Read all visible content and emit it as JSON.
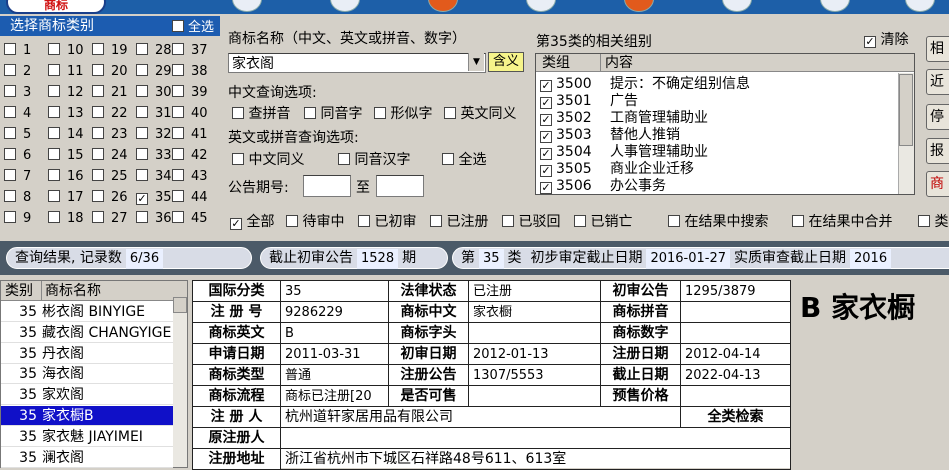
{
  "app": {
    "logo_text": "商标"
  },
  "category_panel": {
    "title": "选择商标类别",
    "select_all": "全选",
    "columns": [
      [
        "1",
        "2",
        "3",
        "4",
        "5",
        "6",
        "7",
        "8",
        "9"
      ],
      [
        "10",
        "11",
        "12",
        "13",
        "14",
        "15",
        "16",
        "17",
        "18"
      ],
      [
        "19",
        "20",
        "21",
        "22",
        "23",
        "24",
        "25",
        "26",
        "27"
      ],
      [
        "28",
        "29",
        "30",
        "31",
        "32",
        "33",
        "34",
        "35",
        "36"
      ],
      [
        "37",
        "38",
        "39",
        "40",
        "41",
        "42",
        "43",
        "44",
        "45"
      ]
    ],
    "checked": [
      "35"
    ]
  },
  "query": {
    "name_label": "商标名称（中文、英文或拼音、数字）",
    "name_value": "家衣阁",
    "contain_button": "含义",
    "cn_options_label": "中文查询选项:",
    "cn_options": [
      "查拼音",
      "同音字",
      "形似字",
      "英文同义"
    ],
    "en_options_label": "英文或拼音查询选项:",
    "en_options": [
      "中文同义",
      "同音汉字",
      "全选"
    ],
    "issue_label": "公告期号:",
    "to_label": "至",
    "issue_from": "",
    "issue_to": ""
  },
  "groups": {
    "title": "第35类的相关组别",
    "clear_label": "清除",
    "col_group": "类组",
    "col_content": "内容",
    "rows": [
      {
        "code": "3500",
        "name": "提示：不确定组别信息"
      },
      {
        "code": "3501",
        "name": "广告"
      },
      {
        "code": "3502",
        "name": "工商管理辅助业"
      },
      {
        "code": "3503",
        "name": "替他人推销"
      },
      {
        "code": "3504",
        "name": "人事管理辅助业"
      },
      {
        "code": "3505",
        "name": "商业企业迁移"
      },
      {
        "code": "3506",
        "name": "办公事务"
      }
    ]
  },
  "right_buttons": [
    "相",
    "近",
    "停",
    "报",
    "商"
  ],
  "filters": {
    "items": [
      "全部",
      "待审中",
      "已初审",
      "已注册",
      "已驳回",
      "已销亡",
      "在结果中搜索",
      "在结果中合并",
      "类"
    ]
  },
  "status": {
    "result_label": "查询结果, 记录数",
    "result_value": "6/36",
    "deadline_label": "截止初审公告",
    "deadline_value": "1528",
    "deadline_suffix": "期",
    "class_prefix": "第",
    "class_value": "35",
    "class_suffix": "类",
    "prelim_label": "初步审定截止日期",
    "prelim_value": "2016-01-27",
    "exam_label": "实质审查截止日期",
    "exam_value": "2016"
  },
  "name_table": {
    "col_class": "类别",
    "col_name": "商标名称",
    "rows": [
      {
        "cls": "35",
        "name": "彬衣阁 BINYIGE"
      },
      {
        "cls": "35",
        "name": "藏衣阁 CHANGYIGE"
      },
      {
        "cls": "35",
        "name": "丹衣阁"
      },
      {
        "cls": "35",
        "name": "海衣阁"
      },
      {
        "cls": "35",
        "name": "家欢阁"
      },
      {
        "cls": "35",
        "name": "家衣橱B"
      },
      {
        "cls": "35",
        "name": "家衣魅 JIAYIMEI"
      },
      {
        "cls": "35",
        "name": "澜衣阁"
      }
    ],
    "selected_index": 5
  },
  "detail": {
    "k_intl_class": "国际分类",
    "v_intl_class": "35",
    "k_legal_status": "法律状态",
    "v_legal_status": "已注册",
    "k_prelim_pub": "初审公告",
    "v_prelim_pub": "1295/3879",
    "k_reg_no": "注 册 号",
    "v_reg_no": "9286229",
    "k_cn_name": "商标中文",
    "v_cn_name": "家衣橱",
    "k_pinyin": "商标拼音",
    "v_pinyin": "",
    "k_en_name": "商标英文",
    "v_en_name": "B",
    "k_initial": "商标字头",
    "v_initial": "",
    "k_digits": "商标数字",
    "v_digits": "",
    "k_apply_date": "申请日期",
    "v_apply_date": "2011-03-31",
    "k_prelim_date": "初审日期",
    "v_prelim_date": "2012-01-13",
    "k_reg_date": "注册日期",
    "v_reg_date": "2012-04-14",
    "k_type": "商标类型",
    "v_type": "普通",
    "k_reg_pub": "注册公告",
    "v_reg_pub": "1307/5553",
    "k_expiry": "截止日期",
    "v_expiry": "2022-04-13",
    "k_flow": "商标流程",
    "v_flow": "商标已注册[20",
    "k_for_sale": "是否可售",
    "v_for_sale": "",
    "k_price": "预售价格",
    "v_price": "",
    "k_registrant": "注 册 人",
    "v_registrant": "杭州道轩家居用品有限公司",
    "full_search": "全类检索",
    "k_orig_registrant": "原注册人",
    "v_orig_registrant": "",
    "k_address": "注册地址",
    "v_address": "浙江省杭州市下城区石祥路48号611、613室"
  },
  "preview": {
    "text": "B 家衣橱"
  }
}
